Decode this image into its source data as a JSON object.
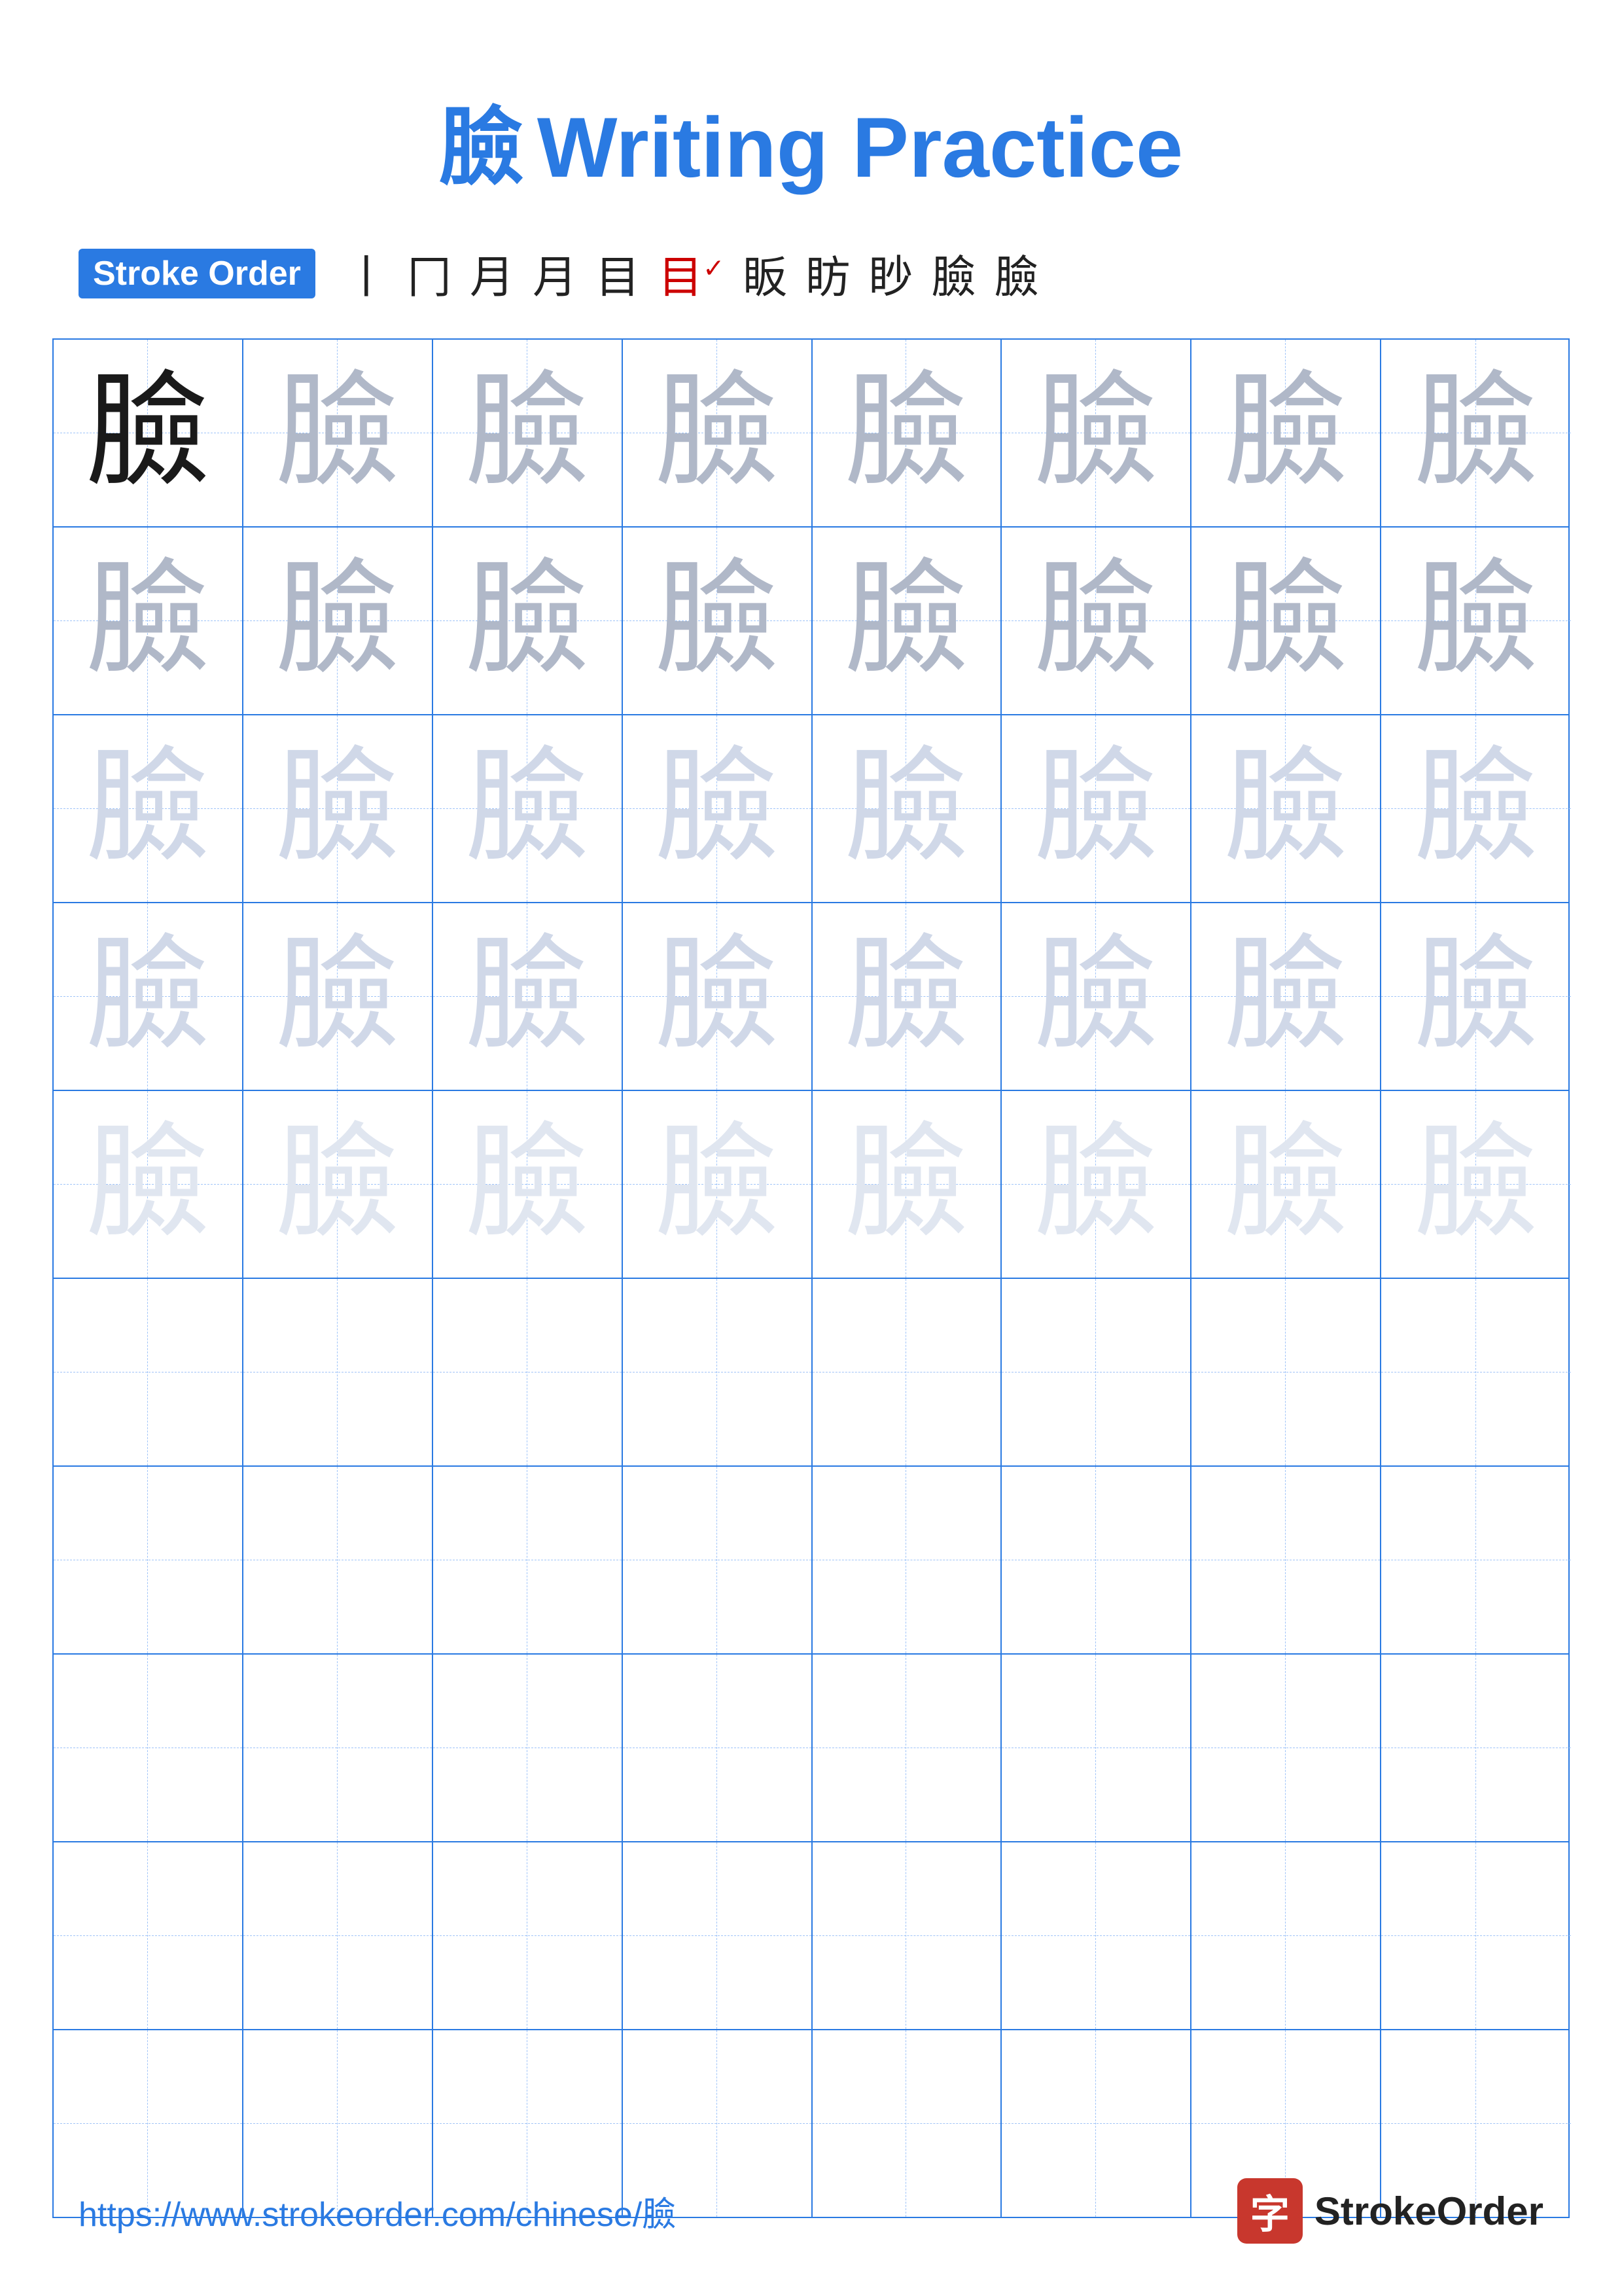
{
  "page": {
    "title_char": "臉",
    "title_text": "Writing Practice"
  },
  "stroke_order": {
    "badge_label": "Stroke Order",
    "steps": [
      "丨",
      "冂",
      "月",
      "月",
      "目",
      "目'",
      "眅",
      "眆",
      "眇",
      "臉",
      "臉"
    ]
  },
  "grid": {
    "rows": 10,
    "cols": 8,
    "char": "臉",
    "filled_rows": 5,
    "empty_rows": 5
  },
  "footer": {
    "url": "https://www.strokeorder.com/chinese/臉",
    "logo_char": "字",
    "logo_text": "StrokeOrder"
  }
}
